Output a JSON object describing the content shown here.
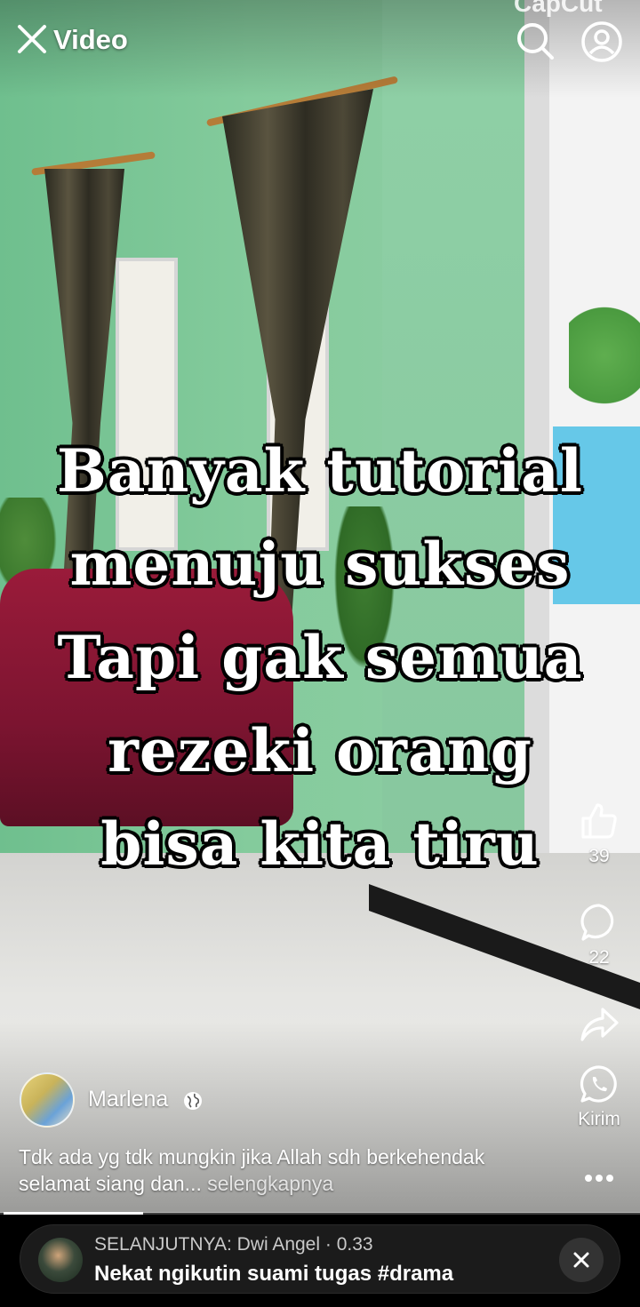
{
  "top_bar": {
    "title": "Video",
    "watermark": "CapCut"
  },
  "overlay_text": {
    "line1": "Banyak tutorial",
    "line2": "menuju sukses",
    "line3": "Tapi gak semua",
    "line4": "rezeki orang",
    "line5": "bisa kita tiru"
  },
  "actions": {
    "like_count": "39",
    "comment_count": "22",
    "send_label": "Kirim"
  },
  "post": {
    "author": "Marlena",
    "caption": "Tdk ada yg tdk mungkin jika Allah sdh berkehendak selamat siang dan...",
    "see_more": "selengkapnya"
  },
  "playback": {
    "progress_fraction": 0.22
  },
  "up_next": {
    "label": "SELANJUTNYA: Dwi Angel · 0.33",
    "title": "Nekat ngikutin suami tugas #drama"
  },
  "colors": {
    "accent": "#ffffff",
    "next_bar_bg": "#1b1b1b",
    "whatsapp": "#ffffff"
  }
}
